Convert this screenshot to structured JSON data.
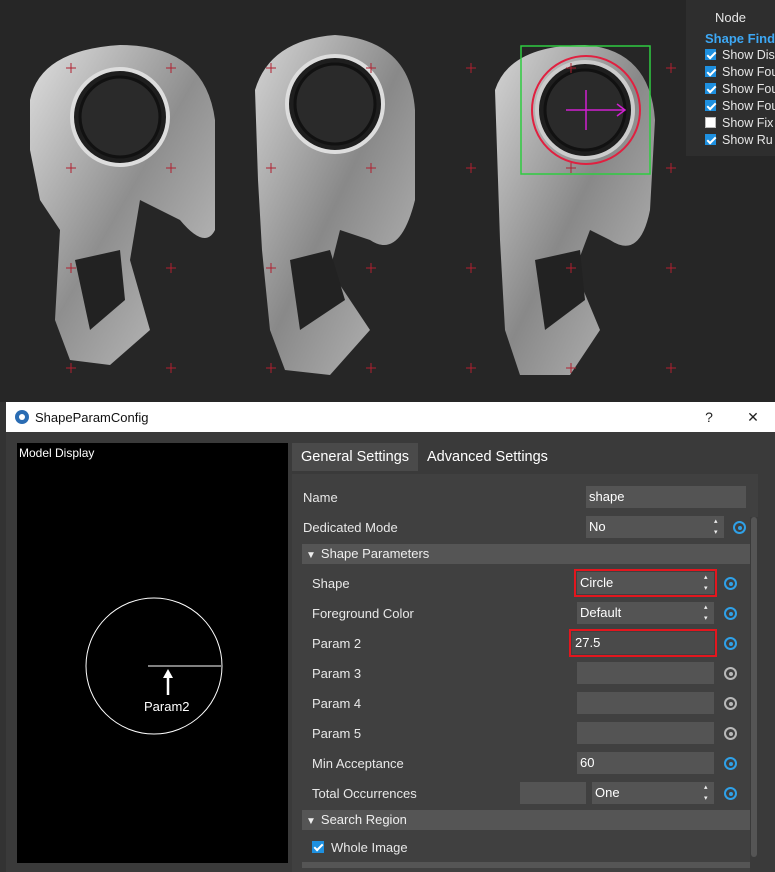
{
  "node_panel": {
    "title": "Node",
    "section": "Shape Finde",
    "items": [
      {
        "label": "Show Dis",
        "checked": true
      },
      {
        "label": "Show Fou",
        "checked": true
      },
      {
        "label": "Show Fou",
        "checked": true
      },
      {
        "label": "Show Fou",
        "checked": true
      },
      {
        "label": "Show Fix",
        "checked": false
      },
      {
        "label": "Show Ru",
        "checked": true
      }
    ]
  },
  "dialog": {
    "title": "ShapeParamConfig",
    "help_label": "?",
    "close_label": "✕",
    "model_display": {
      "label": "Model Display",
      "param_label": "Param2"
    },
    "tabs": [
      {
        "label": "General Settings",
        "active": true
      },
      {
        "label": "Advanced Settings",
        "active": false
      }
    ],
    "fields": {
      "name_label": "Name",
      "name_value": "shape",
      "dedicated_label": "Dedicated Mode",
      "dedicated_value": "No",
      "shape_params_header": "Shape Parameters",
      "shape_label": "Shape",
      "shape_value": "Circle",
      "fg_label": "Foreground Color",
      "fg_value": "Default",
      "param2_label": "Param 2",
      "param2_value": "27.5",
      "param3_label": "Param 3",
      "param4_label": "Param 4",
      "param5_label": "Param 5",
      "minacc_label": "Min Acceptance",
      "minacc_value": "60",
      "totalocc_label": "Total Occurrences",
      "totalocc_value": "One",
      "search_region_header": "Search Region",
      "whole_image_label": "Whole Image"
    }
  },
  "colors": {
    "accent_blue": "#2fa1e8",
    "highlight_red": "#e3161e",
    "detect_green": "#2ecc40",
    "detect_red": "#e02040",
    "detect_magenta": "#d020d0"
  }
}
